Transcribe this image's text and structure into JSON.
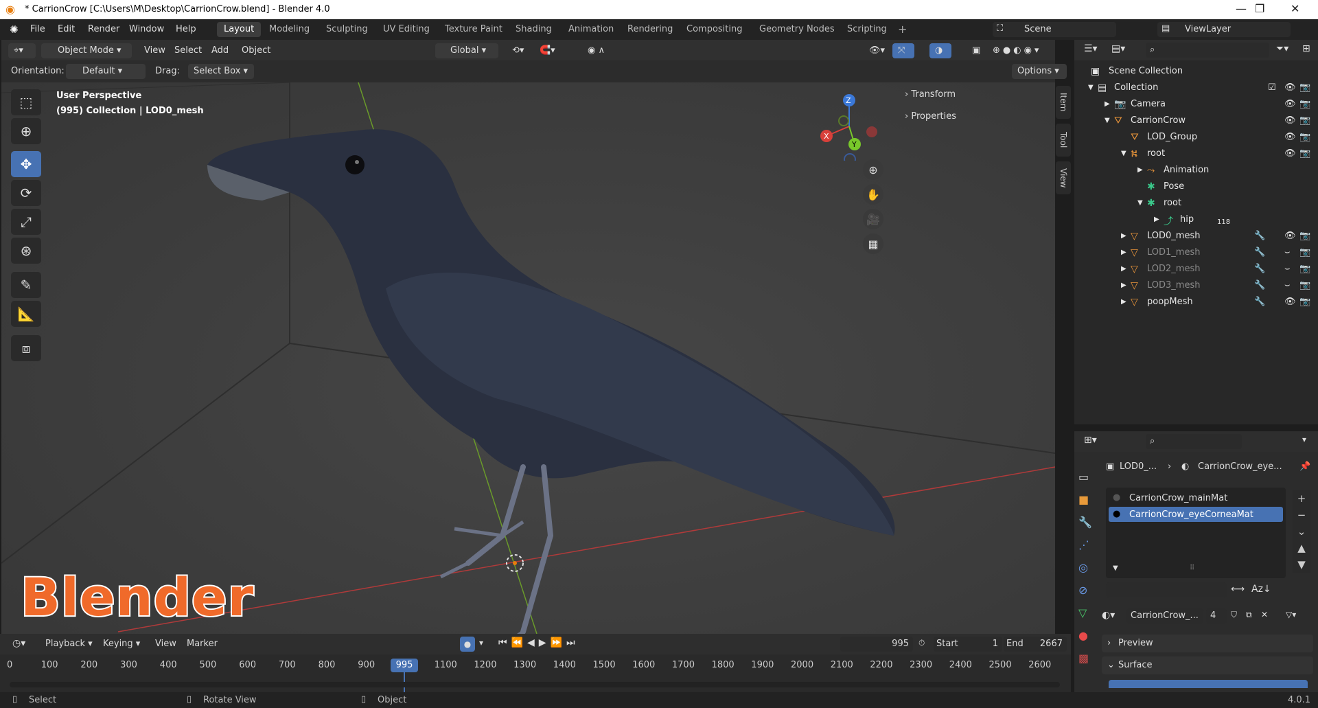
{
  "title": "* CarrionCrow [C:\\Users\\M\\Desktop\\CarrionCrow.blend] - Blender 4.0",
  "menus": [
    "File",
    "Edit",
    "Render",
    "Window",
    "Help"
  ],
  "workspaces": [
    "Layout",
    "Modeling",
    "Sculpting",
    "UV Editing",
    "Texture Paint",
    "Shading",
    "Animation",
    "Rendering",
    "Compositing",
    "Geometry Nodes",
    "Scripting"
  ],
  "scene": "Scene",
  "view_layer": "ViewLayer",
  "viewport_header": {
    "mode": "Object Mode",
    "menus": [
      "View",
      "Select",
      "Add",
      "Object"
    ],
    "transform": "Global"
  },
  "tool_settings": {
    "orientation_label": "Orientation:",
    "orientation": "Default",
    "drag_label": "Drag:",
    "drag": "Select Box",
    "options": "Options"
  },
  "viewport_info": {
    "line1": "User Perspective",
    "line2": "(995) Collection | LOD0_mesh"
  },
  "n_panel": {
    "transform": "Transform",
    "properties": "Properties",
    "tabs": [
      "Item",
      "Tool",
      "View"
    ]
  },
  "gizmo": {
    "x": "X",
    "y": "Y",
    "z": "Z"
  },
  "watermark": "Blender",
  "outliner": {
    "scene_collection": "Scene Collection",
    "rows": [
      {
        "label": "Collection",
        "indent": 1
      },
      {
        "label": "Camera",
        "indent": 2
      },
      {
        "label": "CarrionCrow",
        "indent": 2
      },
      {
        "label": "LOD_Group",
        "indent": 3
      },
      {
        "label": "root",
        "indent": 3
      },
      {
        "label": "Animation",
        "indent": 4
      },
      {
        "label": "Pose",
        "indent": 4
      },
      {
        "label": "root",
        "indent": 4
      },
      {
        "label": "hip",
        "indent": 5,
        "badge": "118"
      },
      {
        "label": "LOD0_mesh",
        "indent": 3
      },
      {
        "label": "LOD1_mesh",
        "indent": 3,
        "dim": true
      },
      {
        "label": "LOD2_mesh",
        "indent": 3,
        "dim": true
      },
      {
        "label": "LOD3_mesh",
        "indent": 3,
        "dim": true
      },
      {
        "label": "poopMesh",
        "indent": 3
      }
    ]
  },
  "properties": {
    "breadcrumb_obj": "LOD0_...",
    "breadcrumb_mat": "CarrionCrow_eye...",
    "slots": [
      "CarrionCrow_mainMat",
      "CarrionCrow_eyeCorneaMat"
    ],
    "material_name": "CarrionCrow_...",
    "users": "4",
    "preview": "Preview",
    "surface": "Surface",
    "sort": "Az"
  },
  "timeline": {
    "menus": [
      "Playback",
      "Keying",
      "View",
      "Marker"
    ],
    "current_frame": "995",
    "start_label": "Start",
    "start": "1",
    "end_label": "End",
    "end": "2667",
    "ticks": [
      "0",
      "100",
      "200",
      "300",
      "400",
      "500",
      "600",
      "700",
      "800",
      "900",
      "1100",
      "1200",
      "1300",
      "1400",
      "1500",
      "1600",
      "1700",
      "1800",
      "1900",
      "2000",
      "2100",
      "2200",
      "2300",
      "2400",
      "2500",
      "2600"
    ]
  },
  "status": {
    "select": "Select",
    "rotate": "Rotate View",
    "object": "Object",
    "version": "4.0.1"
  }
}
